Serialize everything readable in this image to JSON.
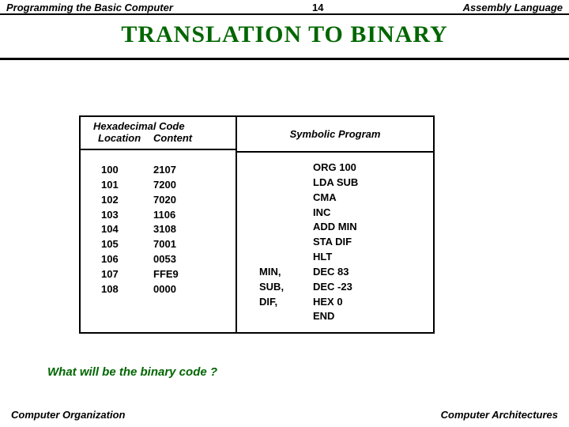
{
  "header": {
    "left": "Programming the Basic Computer",
    "center": "14",
    "right": "Assembly Language"
  },
  "title": "TRANSLATION  TO   BINARY",
  "hex": {
    "title": "Hexadecimal Code",
    "col1": "Location",
    "col2": "Content",
    "rows": [
      {
        "loc": "100",
        "con": "2107"
      },
      {
        "loc": "101",
        "con": "7200"
      },
      {
        "loc": "102",
        "con": "7020"
      },
      {
        "loc": "103",
        "con": "1106"
      },
      {
        "loc": "104",
        "con": "3108"
      },
      {
        "loc": "105",
        "con": "7001"
      },
      {
        "loc": "106",
        "con": "0053"
      },
      {
        "loc": "107",
        "con": "FFE9"
      },
      {
        "loc": "108",
        "con": "0000"
      }
    ]
  },
  "sym": {
    "title": "Symbolic Program",
    "rows": [
      {
        "lab": "",
        "instr": "ORG  100"
      },
      {
        "lab": "",
        "instr": "LDA  SUB"
      },
      {
        "lab": "",
        "instr": "CMA"
      },
      {
        "lab": "",
        "instr": "INC"
      },
      {
        "lab": "",
        "instr": "ADD  MIN"
      },
      {
        "lab": "",
        "instr": "STA  DIF"
      },
      {
        "lab": "",
        "instr": "HLT"
      },
      {
        "lab": "MIN,",
        "instr": "DEC  83"
      },
      {
        "lab": "SUB,",
        "instr": "DEC  -23"
      },
      {
        "lab": "DIF,",
        "instr": "HEX  0"
      },
      {
        "lab": "",
        "instr": "END"
      }
    ]
  },
  "question": "What will be the binary code ?",
  "footer": {
    "left": "Computer Organization",
    "right": "Computer Architectures"
  }
}
